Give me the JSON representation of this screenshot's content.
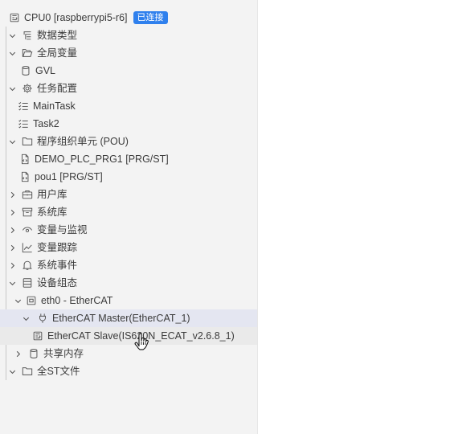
{
  "tree": {
    "root": {
      "label": "CPU0 [raspberrypi5-r6]",
      "status_badge": "已连接"
    },
    "data_types": "数据类型",
    "global_vars": "全局变量",
    "gvl": "GVL",
    "task_config": "任务配置",
    "main_task": "MainTask",
    "task2": "Task2",
    "pou": "程序组织单元 (POU)",
    "demo_prg": "DEMO_PLC_PRG1 [PRG/ST]",
    "pou1": "pou1 [PRG/ST]",
    "user_library": "用户库",
    "system_library": "系统库",
    "var_monitor": "变量与监视",
    "var_trace": "变量跟踪",
    "system_events": "系统事件",
    "device_config": "设备组态",
    "eth0": "eth0 - EtherCAT",
    "ethercat_master": "EtherCAT Master(EtherCAT_1)",
    "ethercat_slave": "EtherCAT Slave(IS620N_ECAT_v2.6.8_1)",
    "shared_memory": "共享内存",
    "st_files": "全ST文件"
  },
  "colors": {
    "panel_bg": "#f3f3f3",
    "badge_bg": "#2f80ed",
    "selected_row": "#e4e6f1"
  }
}
